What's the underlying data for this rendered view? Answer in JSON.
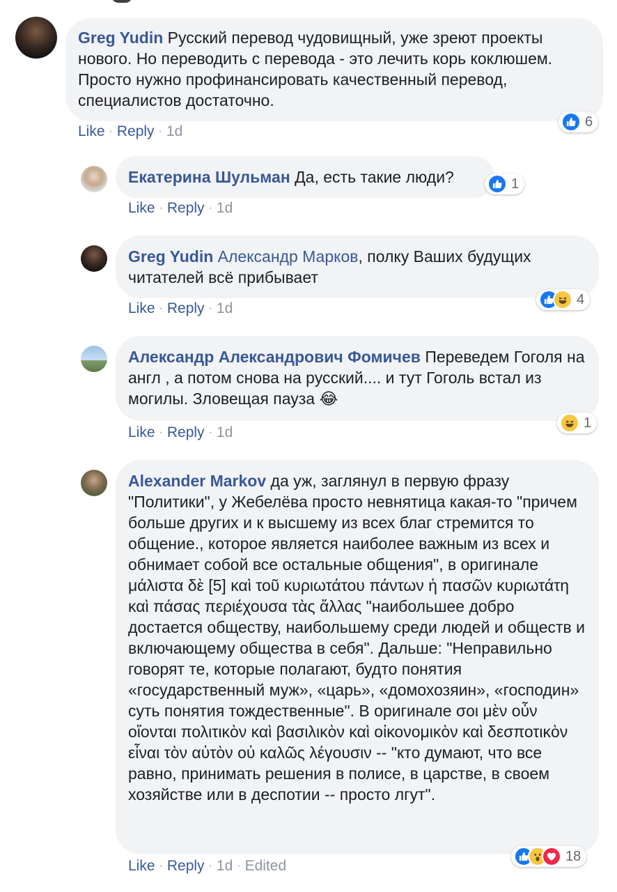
{
  "comments": [
    {
      "author": "Greg Yudin",
      "text": "Русский перевод чудовищный, уже зреют проекты нового. Но переводить с перевода - это лечить корь коклюшем. Просто нужно профинансировать качественный перевод, специалистов достаточно.",
      "like_label": "Like",
      "reply_label": "Reply",
      "time": "1d",
      "reaction_count": "6",
      "reactions": [
        "like"
      ]
    },
    {
      "author": "Екатерина Шульман",
      "text": "Да, есть такие люди?",
      "like_label": "Like",
      "reply_label": "Reply",
      "time": "1d",
      "reaction_count": "1",
      "reactions": [
        "like"
      ]
    },
    {
      "author": "Greg Yudin",
      "mention": "Александр Марков",
      "text": ", полку Ваших будущих читателей всё прибывает",
      "like_label": "Like",
      "reply_label": "Reply",
      "time": "1d",
      "reaction_count": "4",
      "reactions": [
        "like",
        "haha"
      ]
    },
    {
      "author": "Александр Александрович Фомичев",
      "text": "Переведем Гоголя на англ , а потом снова на русский.... и тут Гоголь встал из могилы. Зловещая пауза",
      "emoji": "😂",
      "like_label": "Like",
      "reply_label": "Reply",
      "time": "1d",
      "reaction_count": "1",
      "reactions": [
        "haha"
      ]
    },
    {
      "author": "Alexander Markov",
      "text": "да уж, заглянул в первую фразу \"Политики\", у Жебелёва просто невнятица какая-то \"причем больше других и к высшему из всех благ стремится то общение., которое является наиболее важным из всех и обнимает собой все остальные общения\", в оригинале μάλιστα δὲ [5] καὶ τοῦ κυριωτάτου πάντων ἡ πασῶν κυριωτάτη καὶ πάσας περιέχουσα τὰς ἄλλας \"наибольшее добро достается обществу, наибольшему среди людей и обществ и включающему общества в себя\". Дальше: \"Неправильно говорят те, которые полагают, будто понятия «государственный муж», «царь», «домохозяин», «господин» суть понятия тождественные\". В оригинале σοι μὲν οὖν οἴονται πολιτικὸν καὶ βασιλικὸν καὶ οἰκονομικὸν καὶ δεσποτικὸν εἶναι τὸν αὐτὸν οὐ καλῶς λέγουσιν -- \"кто думают, что все равно, принимать решения в полисе, в царстве, в своем хозяйстве или в деспотии -- просто лгут\".",
      "like_label": "Like",
      "reply_label": "Reply",
      "time": "1d",
      "edited_label": "Edited",
      "reaction_count": "18",
      "reactions": [
        "like",
        "wow",
        "love"
      ]
    }
  ],
  "colors": {
    "link": "#385898",
    "meta": "#8d949e",
    "bubble": "#f2f3f5",
    "like": "#1877f2",
    "haha": "#f7c744",
    "love": "#f0284a"
  }
}
